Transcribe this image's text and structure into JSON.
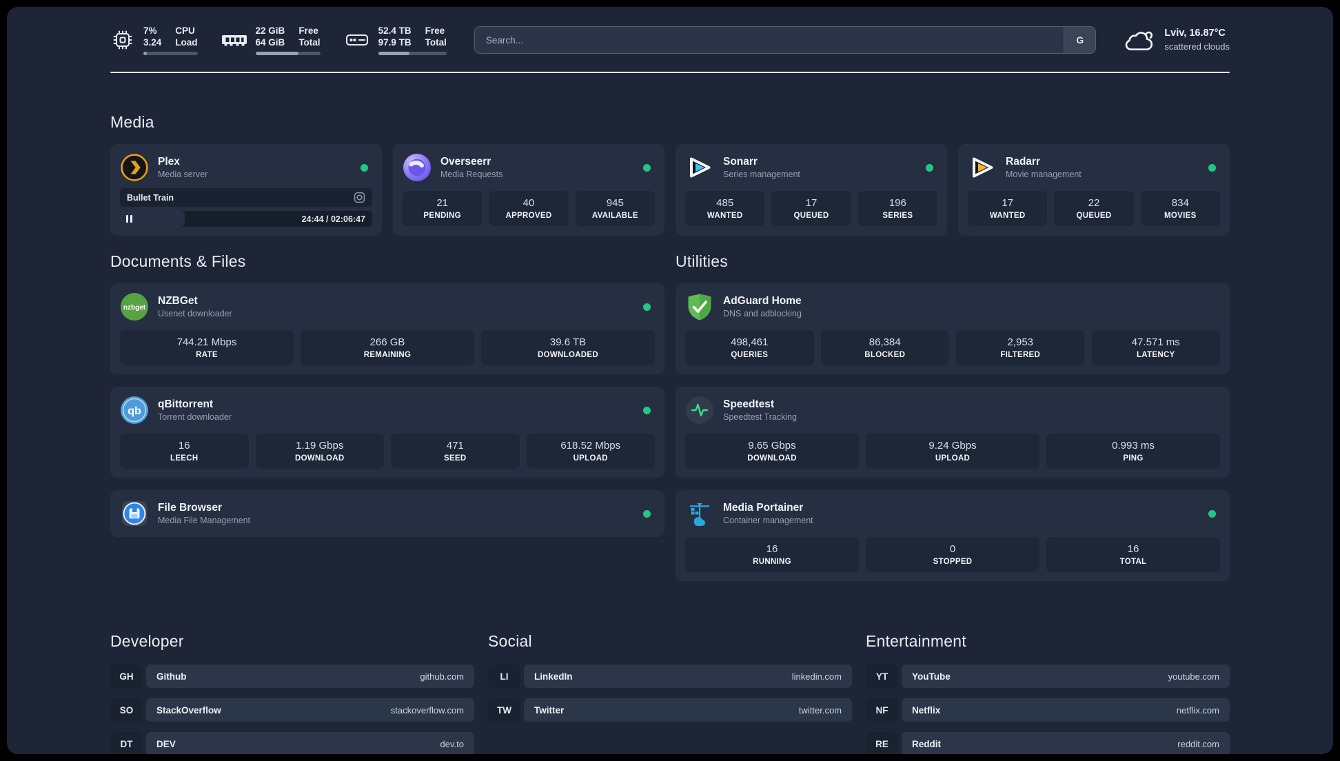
{
  "theme": {
    "status_online": "#25c685",
    "plex_gold": "#e8a117",
    "sonarr_blue": "#38c6f4",
    "radarr_gold": "#f7b32b",
    "adguard_green": "#5fba57",
    "qbittorrent_blue": "#4f9bd9",
    "nzbget_green": "#58a341",
    "filebrowser_blue": "#2f86e8",
    "portainer_blue": "#27a8e0",
    "speedtest_pulse": "#3ddc84"
  },
  "topbar": {
    "metrics": [
      {
        "icon": "cpu-icon",
        "col1_top": "7%",
        "col1_bottom": "3.24",
        "col2_top": "CPU",
        "col2_bottom": "Load",
        "progress": 7
      },
      {
        "icon": "ram-icon",
        "col1_top": "22 GiB",
        "col1_bottom": "64 GiB",
        "col2_top": "Free",
        "col2_bottom": "Total",
        "progress": 66
      },
      {
        "icon": "disk-icon",
        "col1_top": "52.4 TB",
        "col1_bottom": "97.9 TB",
        "col2_top": "Free",
        "col2_bottom": "Total",
        "progress": 46
      }
    ],
    "search": {
      "placeholder": "Search...",
      "provider": "G"
    },
    "weather": {
      "location_temp": "Lviv, 16.87°C",
      "condition": "scattered clouds"
    }
  },
  "media_section": {
    "title": "Media",
    "cards": [
      {
        "name": "Plex",
        "subtitle": "Media server",
        "icon": "plex-icon",
        "status": "online",
        "player": {
          "title": "Bullet Train",
          "state": "paused",
          "time": "24:44 / 02:06:47"
        }
      },
      {
        "name": "Overseerr",
        "subtitle": "Media Requests",
        "icon": "overseerr-icon",
        "status": "online",
        "stats": [
          {
            "value": "21",
            "label": "PENDING"
          },
          {
            "value": "40",
            "label": "APPROVED"
          },
          {
            "value": "945",
            "label": "AVAILABLE"
          }
        ]
      },
      {
        "name": "Sonarr",
        "subtitle": "Series management",
        "icon": "sonarr-icon",
        "status": "online",
        "stats": [
          {
            "value": "485",
            "label": "WANTED"
          },
          {
            "value": "17",
            "label": "QUEUED"
          },
          {
            "value": "196",
            "label": "SERIES"
          }
        ]
      },
      {
        "name": "Radarr",
        "subtitle": "Movie management",
        "icon": "radarr-icon",
        "status": "online",
        "stats": [
          {
            "value": "17",
            "label": "WANTED"
          },
          {
            "value": "22",
            "label": "QUEUED"
          },
          {
            "value": "834",
            "label": "MOVIES"
          }
        ]
      }
    ]
  },
  "columns": [
    {
      "title": "Documents & Files",
      "cards": [
        {
          "name": "NZBGet",
          "subtitle": "Usenet downloader",
          "icon": "nzbget-icon",
          "status": "online",
          "stats": [
            {
              "value": "744.21 Mbps",
              "label": "RATE"
            },
            {
              "value": "266 GB",
              "label": "REMAINING"
            },
            {
              "value": "39.6 TB",
              "label": "DOWNLOADED"
            }
          ]
        },
        {
          "name": "qBittorrent",
          "subtitle": "Torrent downloader",
          "icon": "qbittorrent-icon",
          "status": "online",
          "stats": [
            {
              "value": "16",
              "label": "LEECH"
            },
            {
              "value": "1.19 Gbps",
              "label": "DOWNLOAD"
            },
            {
              "value": "471",
              "label": "SEED"
            },
            {
              "value": "618.52 Mbps",
              "label": "UPLOAD"
            }
          ]
        },
        {
          "name": "File Browser",
          "subtitle": "Media File Management",
          "icon": "filebrowser-icon",
          "status": "online",
          "stats": null
        }
      ]
    },
    {
      "title": "Utilities",
      "cards": [
        {
          "name": "AdGuard Home",
          "subtitle": "DNS and adblocking",
          "icon": "adguard-icon",
          "status": null,
          "stats": [
            {
              "value": "498,461",
              "label": "QUERIES"
            },
            {
              "value": "86,384",
              "label": "BLOCKED"
            },
            {
              "value": "2,953",
              "label": "FILTERED"
            },
            {
              "value": "47.571 ms",
              "label": "LATENCY"
            }
          ]
        },
        {
          "name": "Speedtest",
          "subtitle": "Speedtest Tracking",
          "icon": "speedtest-icon",
          "status": null,
          "stats": [
            {
              "value": "9.65 Gbps",
              "label": "DOWNLOAD"
            },
            {
              "value": "9.24 Gbps",
              "label": "UPLOAD"
            },
            {
              "value": "0.993 ms",
              "label": "PING"
            }
          ]
        },
        {
          "name": "Media Portainer",
          "subtitle": "Container management",
          "icon": "portainer-icon",
          "status": "online",
          "stats": [
            {
              "value": "16",
              "label": "RUNNING"
            },
            {
              "value": "0",
              "label": "STOPPED"
            },
            {
              "value": "16",
              "label": "TOTAL"
            }
          ]
        }
      ]
    }
  ],
  "link_sections": [
    {
      "title": "Developer",
      "links": [
        {
          "abbr": "GH",
          "name": "Github",
          "url": "github.com"
        },
        {
          "abbr": "SO",
          "name": "StackOverflow",
          "url": "stackoverflow.com"
        },
        {
          "abbr": "DT",
          "name": "DEV",
          "url": "dev.to"
        }
      ]
    },
    {
      "title": "Social",
      "links": [
        {
          "abbr": "LI",
          "name": "LinkedIn",
          "url": "linkedin.com"
        },
        {
          "abbr": "TW",
          "name": "Twitter",
          "url": "twitter.com"
        }
      ]
    },
    {
      "title": "Entertainment",
      "links": [
        {
          "abbr": "YT",
          "name": "YouTube",
          "url": "youtube.com"
        },
        {
          "abbr": "NF",
          "name": "Netflix",
          "url": "netflix.com"
        },
        {
          "abbr": "RE",
          "name": "Reddit",
          "url": "reddit.com"
        }
      ]
    }
  ]
}
